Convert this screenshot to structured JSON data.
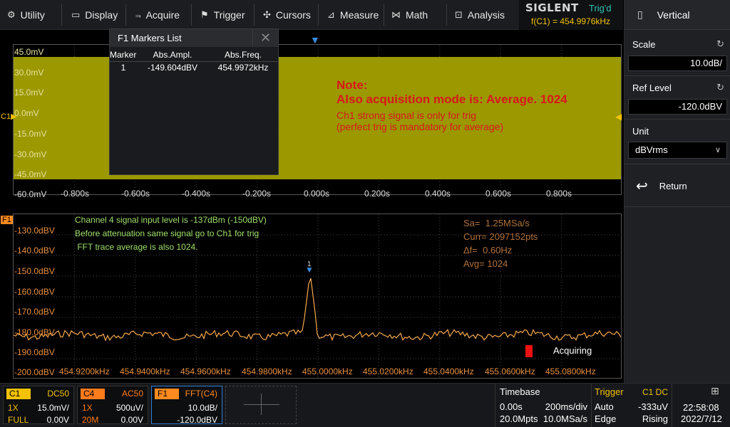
{
  "menu": {
    "items": [
      {
        "label": "Utility",
        "icon": "gear-icon"
      },
      {
        "label": "Display",
        "icon": "monitor-icon"
      },
      {
        "label": "Acquire",
        "icon": "acquire-icon"
      },
      {
        "label": "Trigger",
        "icon": "flag-icon"
      },
      {
        "label": "Cursors",
        "icon": "crosshair-icon"
      },
      {
        "label": "Measure",
        "icon": "measure-icon"
      },
      {
        "label": "Math",
        "icon": "math-icon"
      },
      {
        "label": "Analysis",
        "icon": "analysis-icon"
      }
    ]
  },
  "brand": {
    "logo": "SIGLENT",
    "trig_status": "Trig'd",
    "freq_counter": "f(C1) = 454.9976kHz"
  },
  "panel": {
    "title": "Vertical",
    "scale_label": "Scale",
    "scale_value": "10.0dB/",
    "ref_label": "Ref Level",
    "ref_value": "-120.0dBV",
    "unit_label": "Unit",
    "unit_value": "dBVrms",
    "return_label": "Return"
  },
  "upper": {
    "y_labels": [
      "45.0mV",
      "30.0mV",
      "15.0mV",
      "0.0mV",
      "-15.0mV",
      "-30.0mV",
      "-45.0mV",
      "-60.0mV"
    ],
    "x_labels": [
      "-0.800s",
      "-0.600s",
      "-0.400s",
      "-0.200s",
      "0.000s",
      "0.200s",
      "0.400s",
      "0.600s",
      "0.800s"
    ],
    "channel_marker": "C1"
  },
  "markers_list": {
    "title": "F1 Markers List",
    "columns": [
      "Marker",
      "Abs.Ampl.",
      "Abs.Freq."
    ],
    "rows": [
      {
        "marker": "1",
        "ampl": "-149.604dBV",
        "freq": "454.9972kHz"
      }
    ]
  },
  "note": {
    "line1": "Note:",
    "line2": "Also acquisition mode is: Average. 1024",
    "line3": "Ch1 strong signal is only for trig",
    "line4": "(perfect trig is mandatory for average)"
  },
  "fft": {
    "trace_marker": "F1",
    "y_labels": [
      "-130.0dBV",
      "-140.0dBV",
      "-150.0dBV",
      "-160.0dBV",
      "-170.0dBV",
      "-180.0dBV",
      "-190.0dBV",
      "-200.0dBV"
    ],
    "x_labels": [
      "454.9200kHz",
      "454.9400kHz",
      "454.9600kHz",
      "454.9800kHz",
      "455.0000kHz",
      "455.0200kHz",
      "455.0400kHz",
      "455.0600kHz",
      "455.0800kHz"
    ],
    "annotation": [
      "Channel 4 signal input level is -137dBm (-150dBV)",
      "Before attenuation same signal go to Ch1 for trig",
      " FFT trace average is also 1024."
    ],
    "info": [
      "Sa=  1.25MSa/s",
      "Curr= 2097152pts",
      "Δf=  0.60Hz",
      "Avg= 1024"
    ],
    "peak_marker_label": "1",
    "status": "Acquiring"
  },
  "channels": [
    {
      "tag": "C1",
      "coupling": "DC50",
      "probe": "1X",
      "scale": "15.0mV/",
      "bw": "FULL",
      "offset": "0.00V",
      "color": "#f2c200"
    },
    {
      "tag": "C4",
      "coupling": "AC50",
      "probe": "1X",
      "scale": "500uV/",
      "bw": "20M",
      "offset": "0.00V",
      "color": "#ff7b1c"
    },
    {
      "tag": "F1",
      "coupling": "FFT(C4)",
      "probe": "",
      "scale": "10.0dB/",
      "bw": "",
      "offset": "-120.0dBV",
      "color": "#ff8a1f"
    }
  ],
  "timebase": {
    "title": "Timebase",
    "delay": "0.00s",
    "div": "200ms/div",
    "mpts": "20.0Mpts",
    "sa": "10.0MSa/s"
  },
  "trigger": {
    "title": "Trigger",
    "source": "C1 DC",
    "mode": "Auto",
    "level": "-333uV",
    "type": "Edge",
    "slope": "Rising"
  },
  "clock": {
    "time": "22:58:08",
    "date": "2022/7/12"
  },
  "colors": {
    "accent": "#f2c200",
    "fft": "#ff8a1f",
    "note": "#d81818",
    "trig": "#2ec4b6"
  }
}
